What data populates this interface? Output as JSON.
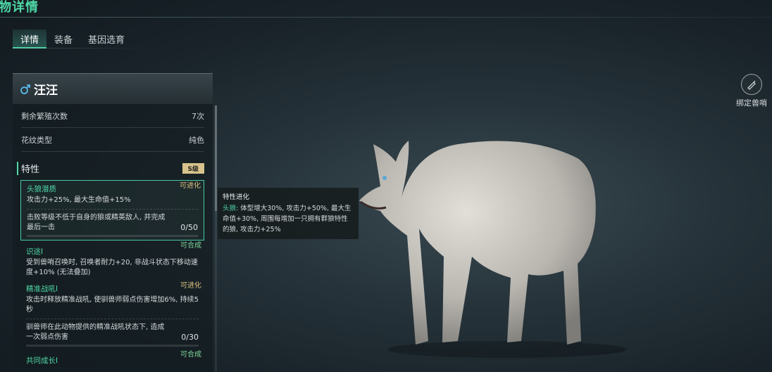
{
  "page": {
    "title": "物详情"
  },
  "tabs": [
    {
      "label": "详情",
      "active": true
    },
    {
      "label": "装备",
      "active": false
    },
    {
      "label": "基因选育",
      "active": false
    }
  ],
  "pet": {
    "name": "汪汪",
    "gender_icon": "male-icon",
    "stats": [
      {
        "label": "剩余繁殖次数",
        "value": "7次"
      },
      {
        "label": "花纹类型",
        "value": "纯色"
      }
    ]
  },
  "traits": {
    "title": "特性",
    "grade": "S级",
    "items": [
      {
        "name": "头狼潜质",
        "tag": "可进化",
        "desc": "攻击力+25%, 最大生命值+15%",
        "task": "击败等级不低于自身的狼或精英敌人, 并完成最后一击",
        "progress": "0/50"
      },
      {
        "name": "识途I",
        "tag": "可合成",
        "desc": "受到兽哨召唤时, 召唤者耐力+20, 非战斗状态下移动速度+10% (无法叠加)"
      },
      {
        "name": "精准战吼I",
        "tag": "可进化",
        "desc": "攻击时释放精准战吼, 使驯兽师弱点伤害增加6%, 持续5秒",
        "task": "驯兽师在此动物提供的精准战吼状态下, 造成一次弱点伤害",
        "progress": "0/30"
      },
      {
        "name": "共同成长I",
        "tag": "可合成"
      }
    ]
  },
  "tooltip": {
    "title": "特性进化",
    "key": "头狼:",
    "text": " 体型增大30%, 攻击力+50%, 最大生命值+30%, 周围每增加一只拥有群狼特性的狼, 攻击力+25%"
  },
  "bind_button": {
    "label": "绑定兽哨",
    "icon": "whistle-icon"
  },
  "colors": {
    "accent": "#4fd6a6",
    "tag_evolve": "#d8c07e",
    "tag_combine": "#7ed49a"
  }
}
